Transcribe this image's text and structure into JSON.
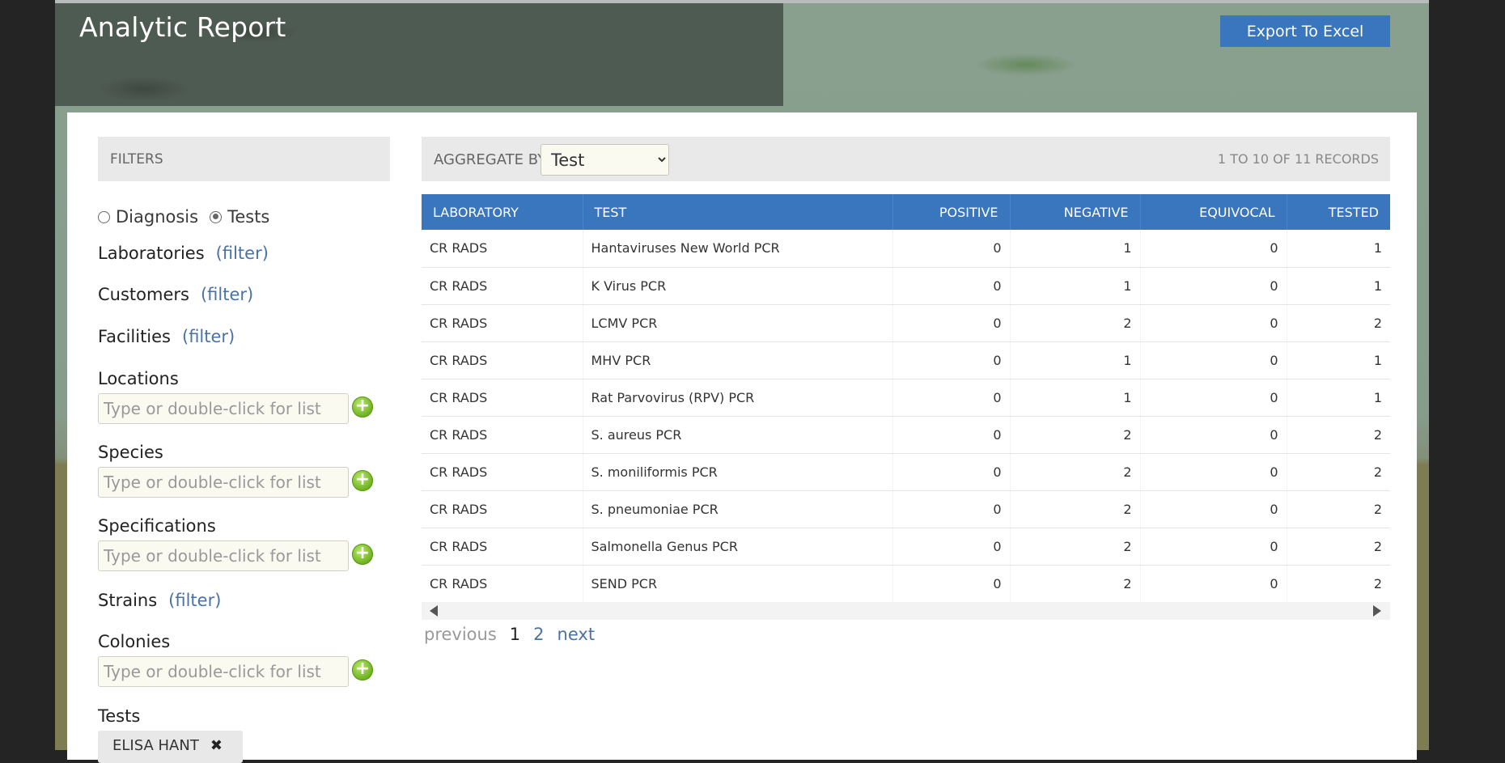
{
  "header": {
    "title": "Analytic Report",
    "export_label": "Export To Excel"
  },
  "filters": {
    "heading": "FILTERS",
    "mode_options": [
      {
        "label": "Diagnosis",
        "checked": false
      },
      {
        "label": "Tests",
        "checked": true
      }
    ],
    "link_text": "(filter)",
    "placeholder": "Type or double-click for list",
    "laboratories": "Laboratories",
    "customers": "Customers",
    "facilities": "Facilities",
    "locations": "Locations",
    "species": "Species",
    "specifications": "Specifications",
    "strains": "Strains",
    "colonies": "Colonies",
    "tests": "Tests",
    "tests_tag": "ELISA HANT"
  },
  "main": {
    "aggregate_label": "AGGREGATE BY",
    "aggregate_value": "Test",
    "records": "1 TO 10 OF 11 RECORDS",
    "columns": [
      "LABORATORY",
      "TEST",
      "POSITIVE",
      "NEGATIVE",
      "EQUIVOCAL",
      "TESTED"
    ],
    "rows": [
      [
        "CR RADS",
        "Hantaviruses New World PCR",
        "0",
        "1",
        "0",
        "1"
      ],
      [
        "CR RADS",
        "K Virus PCR",
        "0",
        "1",
        "0",
        "1"
      ],
      [
        "CR RADS",
        "LCMV PCR",
        "0",
        "2",
        "0",
        "2"
      ],
      [
        "CR RADS",
        "MHV PCR",
        "0",
        "1",
        "0",
        "1"
      ],
      [
        "CR RADS",
        "Rat Parvovirus (RPV) PCR",
        "0",
        "1",
        "0",
        "1"
      ],
      [
        "CR RADS",
        "S. aureus PCR",
        "0",
        "2",
        "0",
        "2"
      ],
      [
        "CR RADS",
        "S. moniliformis PCR",
        "0",
        "2",
        "0",
        "2"
      ],
      [
        "CR RADS",
        "S. pneumoniae PCR",
        "0",
        "2",
        "0",
        "2"
      ],
      [
        "CR RADS",
        "Salmonella Genus PCR",
        "0",
        "2",
        "0",
        "2"
      ],
      [
        "CR RADS",
        "SEND PCR",
        "0",
        "2",
        "0",
        "2"
      ]
    ],
    "pager": {
      "prev": "previous",
      "page1": "1",
      "page2": "2",
      "next": "next"
    }
  },
  "colors": {
    "accent": "#3a76bd",
    "link": "#4a72a8",
    "plus": "#6db01e"
  }
}
